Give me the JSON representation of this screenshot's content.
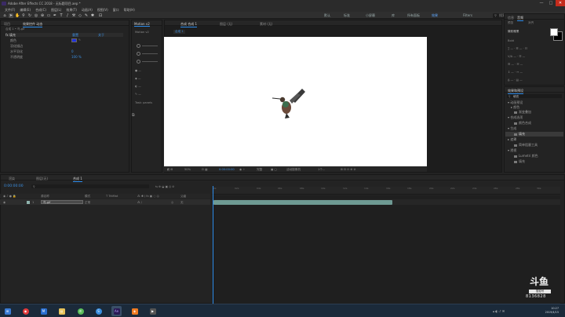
{
  "window": {
    "title": "Adobe After Effects CC 2018 - 无标题项目.aep *",
    "minimize": "—",
    "maximize": "□",
    "close": "✕"
  },
  "menu": [
    "文件(F)",
    "编辑(E)",
    "合成(C)",
    "图层(L)",
    "效果(T)",
    "动画(A)",
    "视图(V)",
    "窗口",
    "帮助(H)"
  ],
  "toolbar": {
    "workspaces": [
      "默认",
      "标准",
      "小屏幕",
      "库",
      "所有面板",
      "效果",
      "Filters"
    ],
    "active_workspace": "效果",
    "search_placeholder": "搜索帮助"
  },
  "effect_controls": {
    "tabs": [
      "项目",
      "效果控件 动态"
    ],
    "layer_header": "合成 1 • 鸟.gif",
    "rows": [
      {
        "label": "fx 填充 ",
        "value": "重置",
        "value2": "关于"
      },
      {
        "label": "颜色",
        "value": ""
      },
      {
        "label": "羽化描边",
        "value": "0"
      },
      {
        "label": "水平羽化",
        "value": "0"
      },
      {
        "label": "不透明度",
        "value": "100 %"
      }
    ],
    "reset_label": "重置"
  },
  "tracker_panel": {
    "tabs": [
      "Motion v2",
      "Motion v2"
    ],
    "task_label": "Task: panels"
  },
  "composition": {
    "tabs": [
      "合成 合成 1",
      "图层 (无)",
      "素材 (无)"
    ],
    "breadcrumb": "合成 1",
    "zoom": "50%",
    "timecode": "0:00:00:00",
    "resolution": "完整",
    "camera": "活动摄像机",
    "views": "1个..."
  },
  "timeline": {
    "tabs": [
      "渲染",
      "图层(无)",
      "合成 1"
    ],
    "timecode": "0:00:00:00",
    "columns": [
      "源名称",
      "模式",
      "T TrkMat",
      "父级"
    ],
    "layer": {
      "index": "1",
      "name": "鸟.gif",
      "mode": "正常",
      "parent": "无"
    },
    "ticks": [
      "0s",
      "02s",
      "04s",
      "06s",
      "08s",
      "10s",
      "12s",
      "14s",
      "16s",
      "18s",
      "20s",
      "22s",
      "24s",
      "26s",
      "28s",
      "30s"
    ]
  },
  "right_panel": {
    "tab_info": "信息",
    "tab_audio": "音频",
    "tab_preview": "预览",
    "tab_align": "对齐",
    "char_font": "微软雅黑",
    "char_style": "Bold",
    "paragraph": "段落",
    "effects_title": "效果和预设",
    "effects_search": "填充",
    "items": [
      {
        "label": "▾ 动画预设",
        "sel": false
      },
      {
        "label": "▸ 颜色",
        "sel": false
      },
      {
        "label": "渐变叠加",
        "sel": false
      },
      {
        "label": "▾ 合成选项",
        "sel": false
      },
      {
        "label": "颜色合成",
        "sel": false
      },
      {
        "label": "▾ 生成",
        "sel": false
      },
      {
        "label": "填充",
        "sel": true
      },
      {
        "label": "▸ 遮罩",
        "sel": false
      },
      {
        "label": "简单阻塞工具",
        "sel": false
      },
      {
        "label": "▾ 透视",
        "sel": false
      },
      {
        "label": "Lumetri 颜色",
        "sel": false
      },
      {
        "label": "填充",
        "sel": false
      }
    ]
  },
  "watermark": {
    "logo": "斗鱼",
    "sub": "搜狐号",
    "number": "8136828"
  },
  "taskbar": {
    "time": "10:27",
    "date": "2019/4/15"
  },
  "colors": {
    "accent": "#2d8ceb",
    "layer_bar": "#6e9a93",
    "panel_bg": "#232323",
    "taskbar": "#1b2a3a"
  }
}
